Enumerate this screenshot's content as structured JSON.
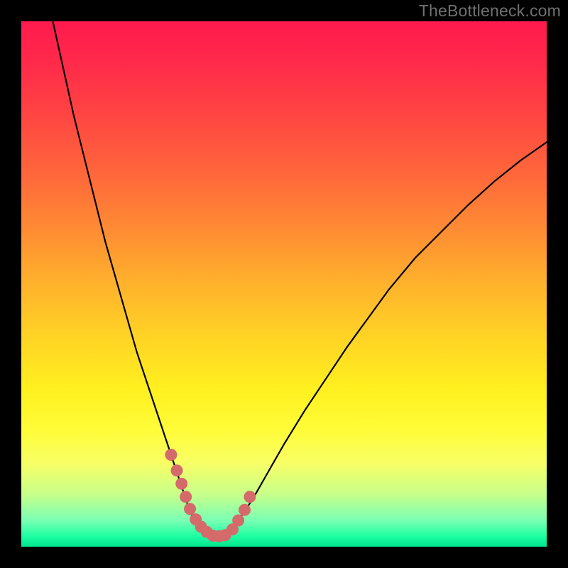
{
  "watermark": "TheBottleneck.com",
  "chart_data": {
    "type": "line",
    "title": "",
    "xlabel": "",
    "ylabel": "",
    "xlim": [
      0,
      100
    ],
    "ylim": [
      0,
      100
    ],
    "series": [
      {
        "name": "bottleneck-curve",
        "x": [
          6,
          8,
          10,
          12,
          14,
          16,
          18,
          20,
          22,
          24,
          26,
          28,
          29,
          30,
          31,
          32,
          33,
          34,
          35,
          36,
          37,
          38,
          40,
          42,
          44,
          46,
          48,
          50,
          54,
          58,
          62,
          66,
          70,
          75,
          80,
          85,
          90,
          95,
          100
        ],
        "y": [
          100,
          91,
          82,
          74,
          66,
          58,
          51,
          44,
          37,
          31,
          25,
          19,
          16,
          13,
          10,
          7,
          5,
          3.5,
          2.5,
          2,
          2,
          2.3,
          3.5,
          6,
          9,
          12.5,
          16,
          19.5,
          26,
          32,
          38,
          43.5,
          49,
          55,
          60,
          65,
          69.5,
          73.5,
          77
        ]
      }
    ],
    "highlight_points": {
      "name": "highlight-dots",
      "x": [
        28.5,
        29.6,
        30.5,
        31.3,
        32.1,
        33.2,
        34.2,
        35.3,
        36.5,
        37.7,
        38.8,
        40.2,
        41.3,
        42.5,
        43.5
      ],
      "y": [
        17.5,
        14.5,
        12.0,
        9.5,
        7.2,
        5.2,
        3.8,
        2.8,
        2.1,
        2.0,
        2.2,
        3.3,
        5.0,
        7.0,
        9.5
      ]
    }
  }
}
